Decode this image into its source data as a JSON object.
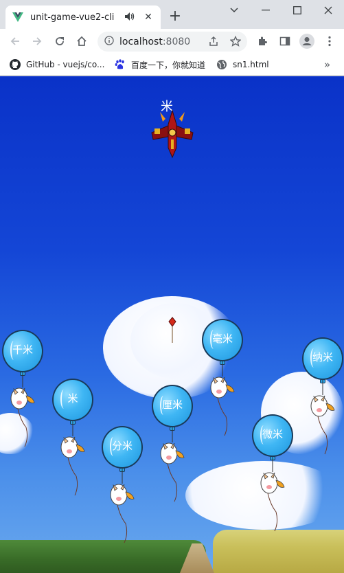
{
  "browser": {
    "tab_title": "unit-game-vue2-cli",
    "url_host": "localhost",
    "url_port": ":8080",
    "bookmarks": [
      {
        "label": "GitHub - vuejs/co...",
        "icon": "github-icon"
      },
      {
        "label": "百度一下，你就知道",
        "icon": "baidu-icon"
      },
      {
        "label": "sn1.html",
        "icon": "globe-icon"
      }
    ],
    "more_bookmarks": "»"
  },
  "game": {
    "plane_label": "米",
    "balloons": [
      {
        "label": "千米"
      },
      {
        "label": "米"
      },
      {
        "label": "分米"
      },
      {
        "label": "厘米"
      },
      {
        "label": "毫米"
      },
      {
        "label": "微米"
      },
      {
        "label": "纳米"
      }
    ]
  },
  "colors": {
    "sky_top": "#0a32c8",
    "balloon": "#3fb6f4",
    "plane": "#b01616"
  }
}
